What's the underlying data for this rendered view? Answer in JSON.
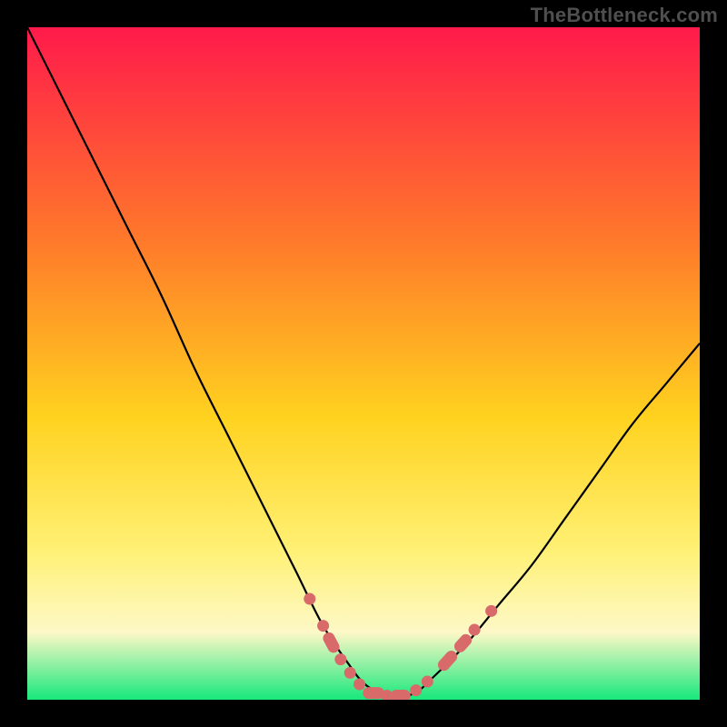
{
  "watermark": "TheBottleneck.com",
  "colors": {
    "frame": "#000000",
    "gradient_top": "#ff1a4b",
    "gradient_mid_upper": "#ff7a2a",
    "gradient_mid": "#ffd21f",
    "gradient_low": "#fff176",
    "gradient_pale": "#fdf8c7",
    "gradient_bottom": "#17e87b",
    "curve": "#000000",
    "marker_fill": "#d86a6a",
    "marker_stroke": "#c95a5a"
  },
  "chart_data": {
    "type": "line",
    "title": "",
    "xlabel": "",
    "ylabel": "",
    "xlim": [
      0,
      100
    ],
    "ylim": [
      0,
      100
    ],
    "series": [
      {
        "name": "bottleneck-curve",
        "x": [
          0,
          5,
          10,
          15,
          20,
          25,
          30,
          35,
          40,
          44,
          48,
          50,
          52,
          54,
          56,
          58,
          60,
          65,
          70,
          75,
          80,
          85,
          90,
          95,
          100
        ],
        "y": [
          100,
          90,
          80,
          70,
          60,
          49,
          39,
          29,
          19,
          11,
          5,
          2.5,
          1.2,
          0.5,
          0.5,
          1.2,
          3,
          8,
          14,
          20,
          27,
          34,
          41,
          47,
          53
        ]
      }
    ],
    "markers": [
      {
        "x": 42.0,
        "y": 15.0,
        "kind": "dot"
      },
      {
        "x": 44.0,
        "y": 11.0,
        "kind": "dot"
      },
      {
        "x": 45.2,
        "y": 8.5,
        "kind": "pill",
        "angle": 62,
        "len": 3.2
      },
      {
        "x": 46.6,
        "y": 6.0,
        "kind": "dot"
      },
      {
        "x": 48.0,
        "y": 4.0,
        "kind": "dot"
      },
      {
        "x": 49.4,
        "y": 2.3,
        "kind": "dot"
      },
      {
        "x": 51.5,
        "y": 1.0,
        "kind": "pill",
        "angle": 0,
        "len": 3.2
      },
      {
        "x": 53.5,
        "y": 0.6,
        "kind": "dot"
      },
      {
        "x": 55.5,
        "y": 0.6,
        "kind": "pill",
        "angle": 0,
        "len": 3.0
      },
      {
        "x": 57.8,
        "y": 1.4,
        "kind": "dot"
      },
      {
        "x": 59.5,
        "y": 2.7,
        "kind": "dot"
      },
      {
        "x": 62.5,
        "y": 5.8,
        "kind": "pill",
        "angle": -48,
        "len": 3.4
      },
      {
        "x": 64.8,
        "y": 8.4,
        "kind": "pill",
        "angle": -48,
        "len": 3.0
      },
      {
        "x": 66.5,
        "y": 10.4,
        "kind": "dot"
      },
      {
        "x": 69.0,
        "y": 13.2,
        "kind": "dot"
      }
    ]
  }
}
